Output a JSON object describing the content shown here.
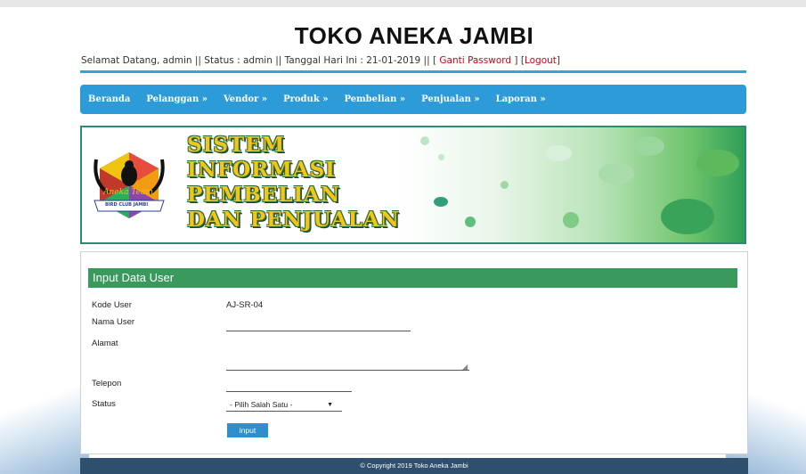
{
  "site": {
    "title": "TOKO ANEKA JAMBI"
  },
  "info": {
    "welcome": "Selamat Datang, admin || Status : admin || Tanggal Hari Ini : 21-01-2019 || [ ",
    "ganti_password": "Ganti Password",
    "middle": " ] [",
    "logout": "Logout",
    "end": "]"
  },
  "nav": {
    "items": [
      "Beranda",
      "Pelanggan »",
      "Vendor »",
      "Produk »",
      "Pembelian »",
      "Penjualan »",
      "Laporan »"
    ]
  },
  "banner": {
    "lines": [
      "SISTEM",
      "INFORMASI",
      "PEMBELIAN",
      "DAN PENJUALAN"
    ],
    "logo_text": "Aneka Team",
    "logo_ribbon": "BIRD CLUB JAMBI"
  },
  "form": {
    "title": "Input Data User",
    "labels": {
      "kode_user": "Kode User",
      "nama_user": "Nama User",
      "alamat": "Alamat",
      "telepon": "Telepon",
      "status": "Status"
    },
    "kode_user_value": "AJ-SR-04",
    "nama_user_value": "",
    "alamat_value": "",
    "telepon_value": "",
    "status_selected": "- Pilih Salah Satu -",
    "submit_label": "input"
  },
  "footer": {
    "text": "© Copyright 2019 Toko Aneka Jambi"
  },
  "colors": {
    "nav_bg": "#2c9bd8",
    "form_header": "#3a9a5d",
    "footer_bg": "#2f4f6f",
    "link_red": "#d0021b"
  }
}
